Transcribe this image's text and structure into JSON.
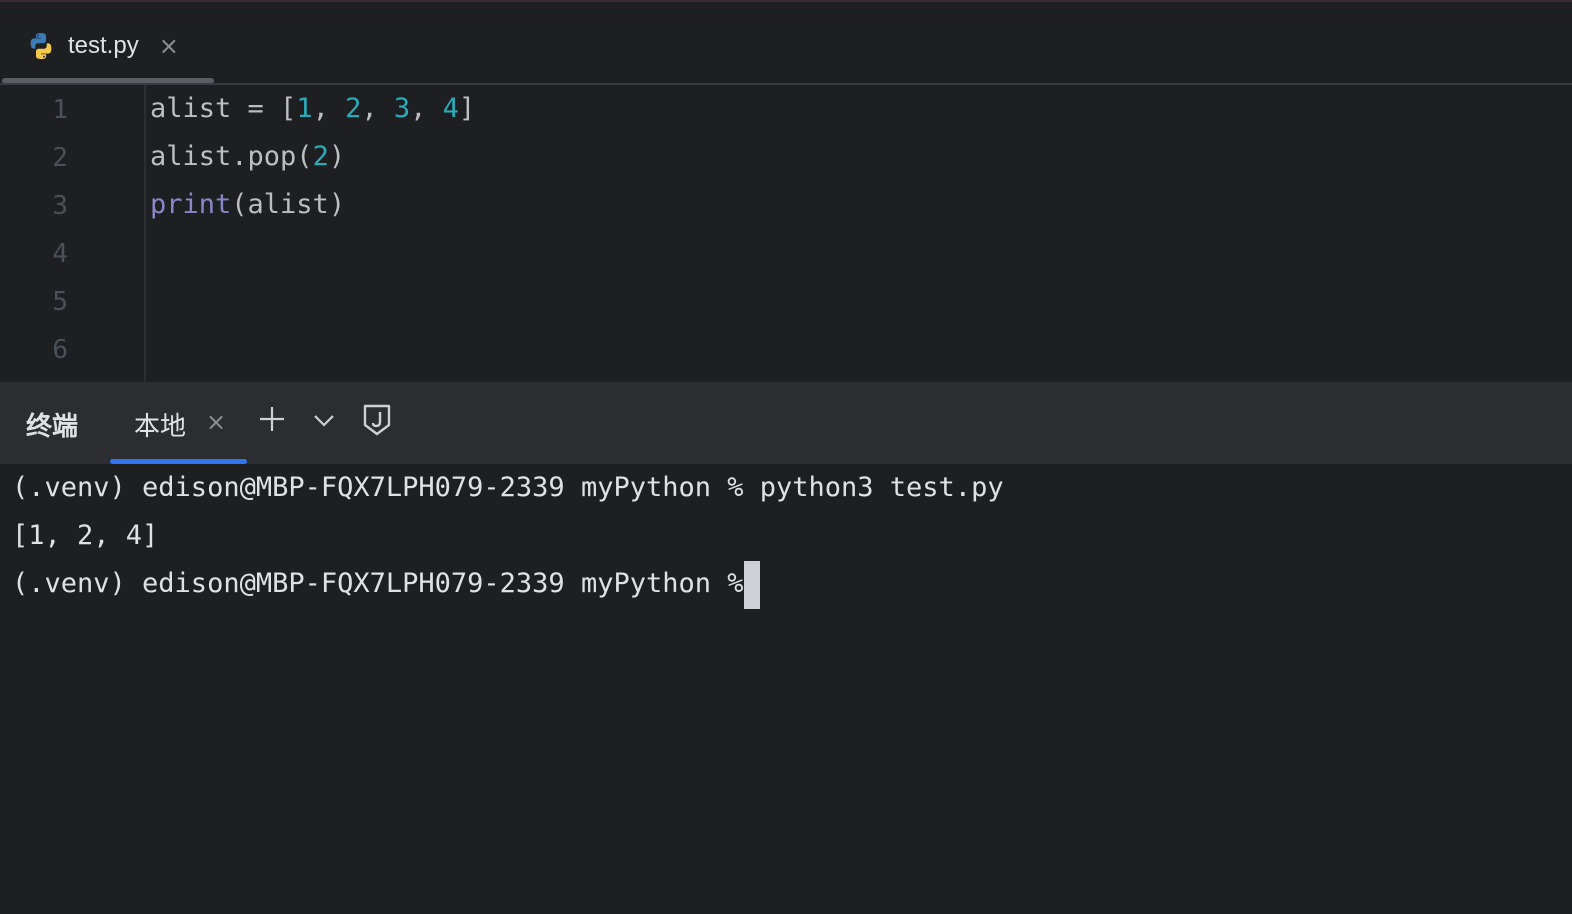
{
  "editor": {
    "tab": {
      "icon": "python-file-icon",
      "label": "test.py",
      "close": "×"
    },
    "line_numbers": [
      "1",
      "2",
      "3",
      "4",
      "5",
      "6"
    ],
    "code": {
      "line1": {
        "a": "alist = [",
        "n1": "1",
        "s1": ", ",
        "n2": "2",
        "s2": ", ",
        "n3": "3",
        "s3": ", ",
        "n4": "4",
        "b": "]"
      },
      "line2": {
        "a": "alist.pop(",
        "n": "2",
        "b": ")"
      },
      "line3": {
        "kw": "print",
        "b": "(alist)"
      }
    }
  },
  "terminal": {
    "title": "终端",
    "tab_label": "本地",
    "tab_close": "×",
    "lines": [
      "(.venv) edison@MBP-FQX7LPH079-2339 myPython % python3 test.py",
      "[1, 2, 4]",
      "(.venv) edison@MBP-FQX7LPH079-2339 myPython % "
    ]
  },
  "colors": {
    "background": "#1e1f22",
    "number": "#2aacb8",
    "keyword": "#8888c6",
    "accent": "#3574f0"
  }
}
